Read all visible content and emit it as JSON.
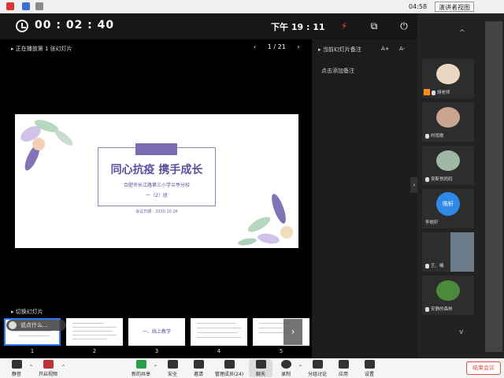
{
  "window": {
    "clock_text": "04:58",
    "view_button": "演讲者视图"
  },
  "toolbar_top": {
    "elapsed": "00 : 02 : 40",
    "clock": "下午 19 : 11"
  },
  "slide_area": {
    "playing_label": "正在播放第 1 张幻灯片",
    "page": "1 / 21",
    "switch_label": "切换幻灯片"
  },
  "slide": {
    "title": "同心抗疫 携手成长",
    "school": "合肥市长江路第三小学兰亭分校",
    "class": "一（2）班",
    "date": "会议日期：2020.10.26"
  },
  "thumbnails": [
    {
      "num": "1",
      "text": ""
    },
    {
      "num": "2",
      "text": ""
    },
    {
      "num": "3",
      "text": "一、线上教学"
    },
    {
      "num": "4",
      "text": ""
    },
    {
      "num": "5",
      "text": ""
    }
  ],
  "overlay_chip": "说点什么...",
  "notes": {
    "title": "当前幻灯片备注",
    "font_up": "A+",
    "font_down": "A-",
    "add_placeholder": "点击添加备注"
  },
  "participants": [
    {
      "name": "胡老师",
      "badge": true
    },
    {
      "name": "时雨歌",
      "badge": false
    },
    {
      "name": "吴靳悦妈妈",
      "badge": false
    },
    {
      "name": "李皓轩",
      "avatar_text": "皓轩",
      "badge": false
    },
    {
      "name": "艺、曦",
      "badge": false
    },
    {
      "name": "安静的森林",
      "badge": false
    }
  ],
  "bottom_toolbar": {
    "mute": "静音",
    "video": "开启视频",
    "share": "新的共享",
    "security": "安全",
    "invite": "邀请",
    "members": "管理成员(24)",
    "chat": "聊天",
    "record": "录制",
    "breakout": "分组讨论",
    "apps": "应用",
    "settings": "设置",
    "end": "结束会议"
  },
  "colors": {
    "accent_purple": "#5a4f9c",
    "end_red": "#e74c3c",
    "selection_blue": "#2f7cf6"
  }
}
